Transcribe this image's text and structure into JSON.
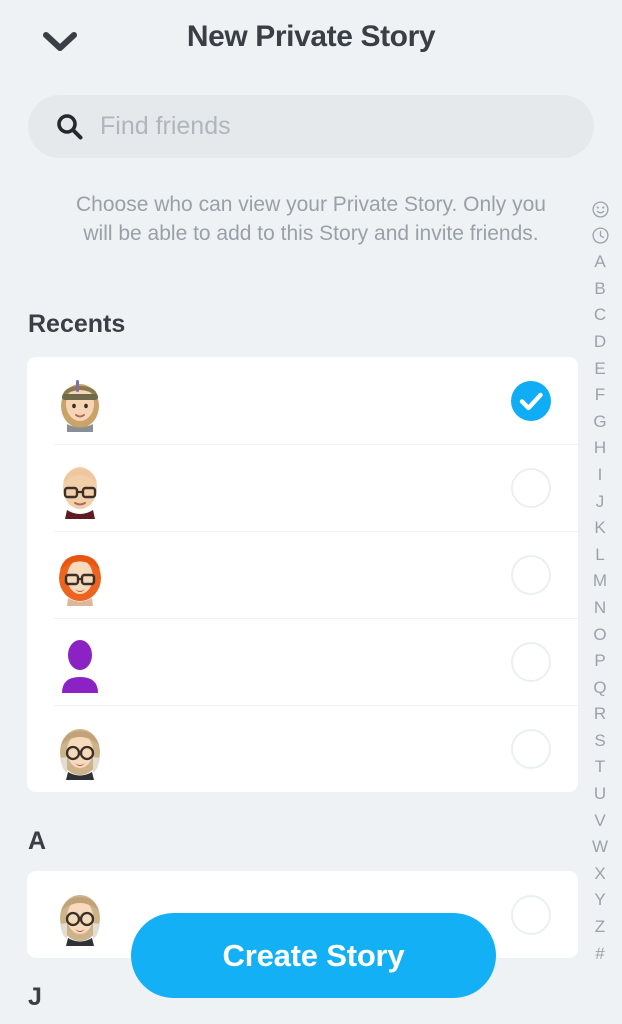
{
  "header": {
    "back_icon": "chevron-down-icon",
    "title": "New Private Story"
  },
  "search": {
    "icon": "search-icon",
    "placeholder": "Find friends",
    "value": ""
  },
  "description": "Choose who can view your Private Story. Only you will be able to add to this Story and invite friends.",
  "sections": [
    {
      "id": "recents",
      "title": "Recents"
    },
    {
      "id": "a",
      "title": "A"
    },
    {
      "id": "j",
      "title": "J"
    }
  ],
  "recents": [
    {
      "name": "",
      "avatar": "bitmoji-blonde-headband",
      "selected": true,
      "toggle_label": "selected"
    },
    {
      "name": "",
      "avatar": "bitmoji-bald-glasses",
      "selected": false,
      "toggle_label": "unselected"
    },
    {
      "name": "",
      "avatar": "bitmoji-redhead-glasses",
      "selected": false,
      "toggle_label": "unselected"
    },
    {
      "name": "",
      "avatar": "default-avatar-purple",
      "selected": false,
      "toggle_label": "unselected"
    },
    {
      "name": "",
      "avatar": "bitmoji-blonde-glasses",
      "selected": false,
      "toggle_label": "unselected"
    }
  ],
  "section_a_rows": [
    {
      "name": "",
      "avatar": "bitmoji-blonde-glasses",
      "selected": false,
      "toggle_label": "unselected"
    }
  ],
  "alpha_index": [
    "smiley-icon",
    "clock-icon",
    "A",
    "B",
    "C",
    "D",
    "E",
    "F",
    "G",
    "H",
    "I",
    "J",
    "K",
    "L",
    "M",
    "N",
    "O",
    "P",
    "Q",
    "R",
    "S",
    "T",
    "U",
    "V",
    "W",
    "X",
    "Y",
    "Z",
    "#"
  ],
  "footer": {
    "create_label": "Create Story"
  },
  "colors": {
    "background": "#eef2f5",
    "card": "#ffffff",
    "accent_blue": "#14b0f5",
    "check_blue": "#0fadf5",
    "title_text": "#3a3f46",
    "muted_text": "#9aa0a8",
    "search_field": "#e5e9ec"
  }
}
